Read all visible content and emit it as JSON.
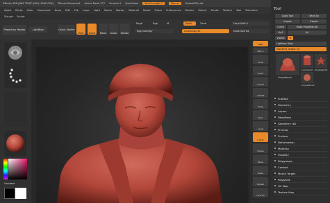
{
  "window": {
    "title": "ZBrush 4R6 [ABS TEMP QUIQ HD60 R26]",
    "document": "ZBrush Document",
    "active_mesh": "Active Mesh 277",
    "scratch": "Scratch 0",
    "quicksave": "QuickSave",
    "see_through": "See-through 0",
    "menus_label": "Menus",
    "default_script": "DefaultZScript"
  },
  "menu": [
    "Alpha",
    "Brush",
    "Color",
    "Document",
    "Draw",
    "Edit",
    "File",
    "Layer",
    "Light",
    "Macro",
    "Marker",
    "Material",
    "Movie",
    "Picker",
    "Preferences",
    "Render",
    "Stencil",
    "Stroke",
    "Texture",
    "Tool",
    "Transform"
  ],
  "menu2": [
    "Zplugin",
    "Zscript"
  ],
  "shelf": {
    "projection_master": "Projection Master",
    "lightbox": "LightBox",
    "quick_sketch": "Quick Sketch",
    "edit": "Edit",
    "draw": "Draw",
    "move": "Move",
    "scale": "Scale",
    "rotate": "Rotate",
    "mrgb": "Mrgb",
    "rgb": "Rgb",
    "m": "M",
    "rgb_intensity": "Rgb Intensity",
    "zadd": "Zadd",
    "zsub": "Zsub",
    "z_intensity": "Z Intensity 25",
    "focal_shift": "Focal Shift 0",
    "draw_size": "Draw Size 64"
  },
  "left": {
    "gradient": "Gradient"
  },
  "right_tools": [
    "BPR",
    "SPix 3",
    "Scroll",
    "Zoom",
    "Actual",
    "AAHalf",
    "Persp",
    "Floor",
    "Local",
    "L.Sym",
    "Frame",
    "Move",
    "Scale",
    "Rotate",
    "Line Fill",
    "Transp",
    "Dynamic",
    "Solo"
  ],
  "tool_panel": {
    "title": "Tool",
    "load_tool": "Load Tool",
    "save_as": "Save As",
    "import": "Import",
    "export": "Export",
    "clone": "Clone",
    "make_polymesh3d": "Make PolyMesh3D",
    "goz": "GoZ",
    "all": "All",
    "visible": "Visible",
    "r": "R",
    "lightbox_tools": "Lightbox Tools",
    "current_tool": "manshirt_model. 41",
    "thumbs": [
      "SimpleBrush",
      "Cylinder3D",
      "PolyMesh3D",
      "SimpleBrush"
    ],
    "sections": [
      "SubTool",
      "Geometry",
      "Layers",
      "FiberMesh",
      "Geometry HD",
      "Preview",
      "Surface",
      "Deformation",
      "Masking",
      "Visibility",
      "Polygroups",
      "Contact",
      "Morph Target",
      "Polypaint",
      "UV Map",
      "Texture Map"
    ]
  },
  "colors": {
    "accent": "#e88a2a",
    "model": "#b2463a"
  }
}
